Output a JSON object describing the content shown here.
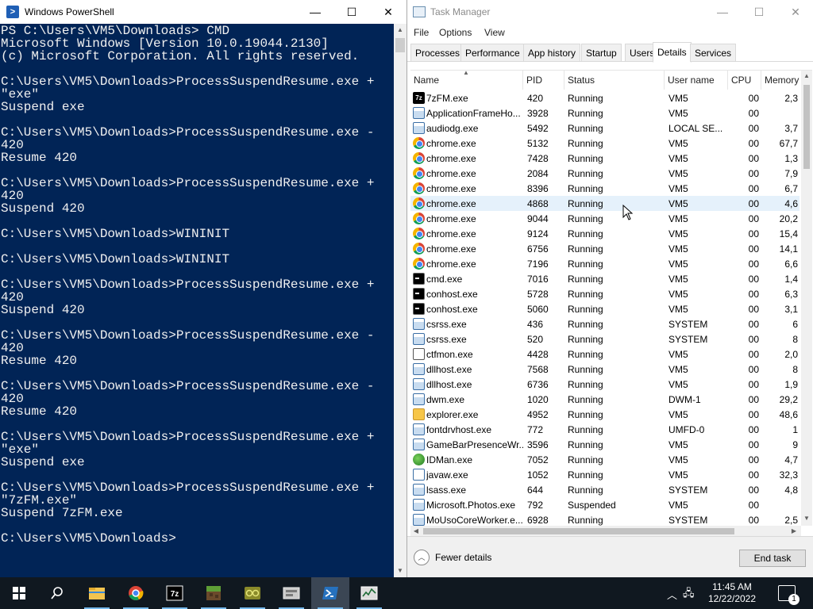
{
  "powershell": {
    "title": "Windows PowerShell",
    "console_lines": [
      "PS C:\\Users\\VM5\\Downloads> CMD",
      "Microsoft Windows [Version 10.0.19044.2130]",
      "(c) Microsoft Corporation. All rights reserved.",
      "",
      "C:\\Users\\VM5\\Downloads>ProcessSuspendResume.exe +",
      "\"exe\"",
      "Suspend exe",
      "",
      "C:\\Users\\VM5\\Downloads>ProcessSuspendResume.exe -",
      "420",
      "Resume 420",
      "",
      "C:\\Users\\VM5\\Downloads>ProcessSuspendResume.exe +",
      "420",
      "Suspend 420",
      "",
      "C:\\Users\\VM5\\Downloads>WININIT",
      "",
      "C:\\Users\\VM5\\Downloads>WININIT",
      "",
      "C:\\Users\\VM5\\Downloads>ProcessSuspendResume.exe +",
      "420",
      "Suspend 420",
      "",
      "C:\\Users\\VM5\\Downloads>ProcessSuspendResume.exe -",
      "420",
      "Resume 420",
      "",
      "C:\\Users\\VM5\\Downloads>ProcessSuspendResume.exe -",
      "420",
      "Resume 420",
      "",
      "C:\\Users\\VM5\\Downloads>ProcessSuspendResume.exe +",
      "\"exe\"",
      "Suspend exe",
      "",
      "C:\\Users\\VM5\\Downloads>ProcessSuspendResume.exe +",
      "\"7zFM.exe\"",
      "Suspend 7zFM.exe",
      "",
      "C:\\Users\\VM5\\Downloads>"
    ],
    "colors": {
      "background": "#012456",
      "text": "#f0f0f0"
    }
  },
  "task_manager": {
    "title": "Task Manager",
    "menu": [
      "File",
      "Options",
      "View"
    ],
    "tabs": [
      "Processes",
      "Performance",
      "App history",
      "Startup",
      "Users",
      "Details",
      "Services"
    ],
    "active_tab": "Details",
    "columns": [
      "Name",
      "PID",
      "Status",
      "User name",
      "CPU",
      "Memory"
    ],
    "rows": [
      {
        "icon": "7z",
        "name": "7zFM.exe",
        "pid": "420",
        "status": "Running",
        "user": "VM5",
        "cpu": "00",
        "memory": "2,3"
      },
      {
        "icon": "generic",
        "name": "ApplicationFrameHo...",
        "pid": "3928",
        "status": "Running",
        "user": "VM5",
        "cpu": "00",
        "memory": ""
      },
      {
        "icon": "generic",
        "name": "audiodg.exe",
        "pid": "5492",
        "status": "Running",
        "user": "LOCAL SE...",
        "cpu": "00",
        "memory": "3,7"
      },
      {
        "icon": "chrome",
        "name": "chrome.exe",
        "pid": "5132",
        "status": "Running",
        "user": "VM5",
        "cpu": "00",
        "memory": "67,7"
      },
      {
        "icon": "chrome",
        "name": "chrome.exe",
        "pid": "7428",
        "status": "Running",
        "user": "VM5",
        "cpu": "00",
        "memory": "1,3"
      },
      {
        "icon": "chrome",
        "name": "chrome.exe",
        "pid": "2084",
        "status": "Running",
        "user": "VM5",
        "cpu": "00",
        "memory": "7,9"
      },
      {
        "icon": "chrome",
        "name": "chrome.exe",
        "pid": "8396",
        "status": "Running",
        "user": "VM5",
        "cpu": "00",
        "memory": "6,7"
      },
      {
        "icon": "chrome",
        "name": "chrome.exe",
        "pid": "4868",
        "status": "Running",
        "user": "VM5",
        "cpu": "00",
        "memory": "4,6"
      },
      {
        "icon": "chrome",
        "name": "chrome.exe",
        "pid": "9044",
        "status": "Running",
        "user": "VM5",
        "cpu": "00",
        "memory": "20,2"
      },
      {
        "icon": "chrome",
        "name": "chrome.exe",
        "pid": "9124",
        "status": "Running",
        "user": "VM5",
        "cpu": "00",
        "memory": "15,4"
      },
      {
        "icon": "chrome",
        "name": "chrome.exe",
        "pid": "6756",
        "status": "Running",
        "user": "VM5",
        "cpu": "00",
        "memory": "14,1"
      },
      {
        "icon": "chrome",
        "name": "chrome.exe",
        "pid": "7196",
        "status": "Running",
        "user": "VM5",
        "cpu": "00",
        "memory": "6,6"
      },
      {
        "icon": "console",
        "name": "cmd.exe",
        "pid": "7016",
        "status": "Running",
        "user": "VM5",
        "cpu": "00",
        "memory": "1,4"
      },
      {
        "icon": "console",
        "name": "conhost.exe",
        "pid": "5728",
        "status": "Running",
        "user": "VM5",
        "cpu": "00",
        "memory": "6,3"
      },
      {
        "icon": "console",
        "name": "conhost.exe",
        "pid": "5060",
        "status": "Running",
        "user": "VM5",
        "cpu": "00",
        "memory": "3,1"
      },
      {
        "icon": "generic",
        "name": "csrss.exe",
        "pid": "436",
        "status": "Running",
        "user": "SYSTEM",
        "cpu": "00",
        "memory": "6"
      },
      {
        "icon": "generic",
        "name": "csrss.exe",
        "pid": "520",
        "status": "Running",
        "user": "SYSTEM",
        "cpu": "00",
        "memory": "8"
      },
      {
        "icon": "pen",
        "name": "ctfmon.exe",
        "pid": "4428",
        "status": "Running",
        "user": "VM5",
        "cpu": "00",
        "memory": "2,0"
      },
      {
        "icon": "generic",
        "name": "dllhost.exe",
        "pid": "7568",
        "status": "Running",
        "user": "VM5",
        "cpu": "00",
        "memory": "8"
      },
      {
        "icon": "generic",
        "name": "dllhost.exe",
        "pid": "6736",
        "status": "Running",
        "user": "VM5",
        "cpu": "00",
        "memory": "1,9"
      },
      {
        "icon": "generic",
        "name": "dwm.exe",
        "pid": "1020",
        "status": "Running",
        "user": "DWM-1",
        "cpu": "00",
        "memory": "29,2"
      },
      {
        "icon": "folder",
        "name": "explorer.exe",
        "pid": "4952",
        "status": "Running",
        "user": "VM5",
        "cpu": "00",
        "memory": "48,6"
      },
      {
        "icon": "generic",
        "name": "fontdrvhost.exe",
        "pid": "772",
        "status": "Running",
        "user": "UMFD-0",
        "cpu": "00",
        "memory": "1"
      },
      {
        "icon": "generic",
        "name": "GameBarPresenceWr...",
        "pid": "3596",
        "status": "Running",
        "user": "VM5",
        "cpu": "00",
        "memory": "9"
      },
      {
        "icon": "idm",
        "name": "IDMan.exe",
        "pid": "7052",
        "status": "Running",
        "user": "VM5",
        "cpu": "00",
        "memory": "4,7"
      },
      {
        "icon": "java",
        "name": "javaw.exe",
        "pid": "1052",
        "status": "Running",
        "user": "VM5",
        "cpu": "00",
        "memory": "32,3"
      },
      {
        "icon": "generic",
        "name": "lsass.exe",
        "pid": "644",
        "status": "Running",
        "user": "SYSTEM",
        "cpu": "00",
        "memory": "4,8"
      },
      {
        "icon": "generic",
        "name": "Microsoft.Photos.exe",
        "pid": "792",
        "status": "Suspended",
        "user": "VM5",
        "cpu": "00",
        "memory": ""
      },
      {
        "icon": "generic",
        "name": "MoUsoCoreWorker.e...",
        "pid": "6928",
        "status": "Running",
        "user": "SYSTEM",
        "cpu": "00",
        "memory": "2,5"
      }
    ],
    "highlighted_row": 7,
    "fewer_details_label": "Fewer details",
    "end_task_label": "End task"
  },
  "taskbar": {
    "items": [
      "windows-start-icon",
      "search-icon",
      "file-explorer-icon",
      "chrome-icon",
      "7zip-icon",
      "minecraft-icon",
      "app-icon",
      "app-icon",
      "powershell-icon",
      "task-manager-icon"
    ],
    "time": "11:45 AM",
    "date": "12/22/2022",
    "notification_count": "1"
  }
}
